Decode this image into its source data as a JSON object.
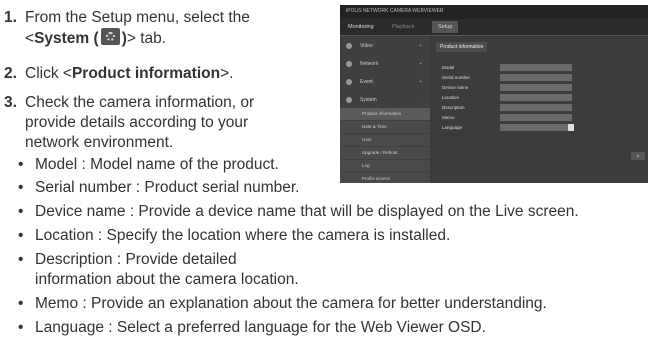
{
  "steps": [
    {
      "num": "1.",
      "pre": "From the Setup menu, select the",
      "line2_pre": "<",
      "line2_bold": "System (",
      "line2_bold2": ")",
      "line2_post": "> tab."
    },
    {
      "num": "2.",
      "pre": "Click <",
      "bold": "Product information",
      "post": ">."
    },
    {
      "num": "3.",
      "lines": [
        "Check the camera information, or",
        "provide details according to your",
        "network environment."
      ]
    }
  ],
  "bullets": [
    {
      "text": "Model : Model name of the product."
    },
    {
      "text": "Serial number : Product serial number."
    },
    {
      "text": "Device name : Provide a device name that will be displayed on the Live screen."
    },
    {
      "text": "Location : Specify the location where the camera is installed."
    },
    {
      "text": "Description : Provide detailed",
      "cont": "information about the camera location."
    },
    {
      "text": "Memo : Provide an explanation about the camera for better understanding."
    },
    {
      "text": "Language : Select a preferred language for the Web Viewer OSD."
    }
  ],
  "bullet_symbol": "•",
  "screenshot": {
    "brand": "iPOLiS NETWORK CAMERA WEBVIEWER",
    "tabs": [
      "Monitoring",
      "Playback",
      "Setup"
    ],
    "menu": [
      {
        "label": "Video",
        "arrow": "+"
      },
      {
        "label": "Network",
        "arrow": "+"
      },
      {
        "label": "Event",
        "arrow": "+"
      },
      {
        "label": "System",
        "arrow": "-"
      }
    ],
    "submenu": [
      "Product information",
      "Date & Time",
      "User",
      "Upgrade / Reboot",
      "Log",
      "Profile access"
    ],
    "panel_title": "Product information",
    "fields": [
      {
        "label": "Model",
        "value": ""
      },
      {
        "label": "Serial number",
        "value": ""
      },
      {
        "label": "Device name",
        "value": ""
      },
      {
        "label": "Location",
        "value": ""
      },
      {
        "label": "Description",
        "value": ""
      },
      {
        "label": "Memo",
        "value": ""
      },
      {
        "label": "Language",
        "value": ""
      }
    ],
    "apply": "A"
  }
}
